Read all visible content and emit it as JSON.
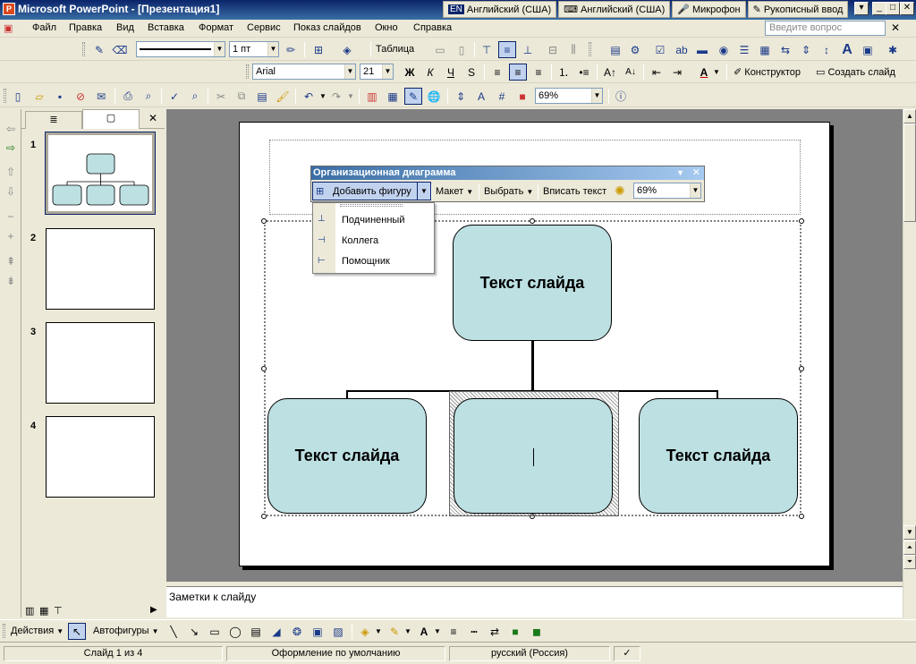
{
  "window": {
    "title": "Microsoft PowerPoint - [Презентация1]",
    "app_icon": "powerpoint-icon",
    "controls": [
      "minimize",
      "maximize",
      "close"
    ]
  },
  "langbar": {
    "items": [
      {
        "code": "EN",
        "label": "Английский (США)"
      },
      {
        "label": "Английский (США)"
      },
      {
        "label": "Микрофон"
      },
      {
        "label": "Рукописный ввод"
      }
    ]
  },
  "menubar": {
    "items": [
      "Файл",
      "Правка",
      "Вид",
      "Вставка",
      "Формат",
      "Сервис",
      "Показ слайдов",
      "Окно",
      "Справка"
    ],
    "ask_placeholder": "Введите вопрос"
  },
  "table_toolbar": {
    "line_width": "1 пт",
    "table_label": "Таблица"
  },
  "format_toolbar": {
    "font": "Arial",
    "size": "21",
    "designer": "Конструктор",
    "new_slide": "Создать слайд"
  },
  "standard_toolbar": {
    "zoom": "69%"
  },
  "left_panel": {
    "tabs": [
      "outline-tab",
      "slides-tab"
    ],
    "slides": [
      {
        "number": "1"
      },
      {
        "number": "2"
      },
      {
        "number": "3"
      },
      {
        "number": "4"
      }
    ]
  },
  "org_toolbar": {
    "title": "Организационная диаграмма",
    "add_shape": "Добавить фигуру",
    "layout": "Макет",
    "select": "Выбрать",
    "fit_text": "Вписать текст",
    "zoom": "69%"
  },
  "add_shape_menu": {
    "items": [
      "Подчиненный",
      "Коллега",
      "Помощник"
    ]
  },
  "slide": {
    "top_node": "Текст слайда",
    "left_node": "Текст слайда",
    "middle_node": "",
    "right_node": "Текст слайда",
    "node_color": "#bde0e2"
  },
  "notes": {
    "placeholder": "Заметки к слайду"
  },
  "drawing_toolbar": {
    "actions": "Действия",
    "autoshapes": "Автофигуры"
  },
  "statusbar": {
    "slide_info": "Слайд 1 из 4",
    "design": "Оформление по умолчанию",
    "language": "русский (Россия)"
  }
}
